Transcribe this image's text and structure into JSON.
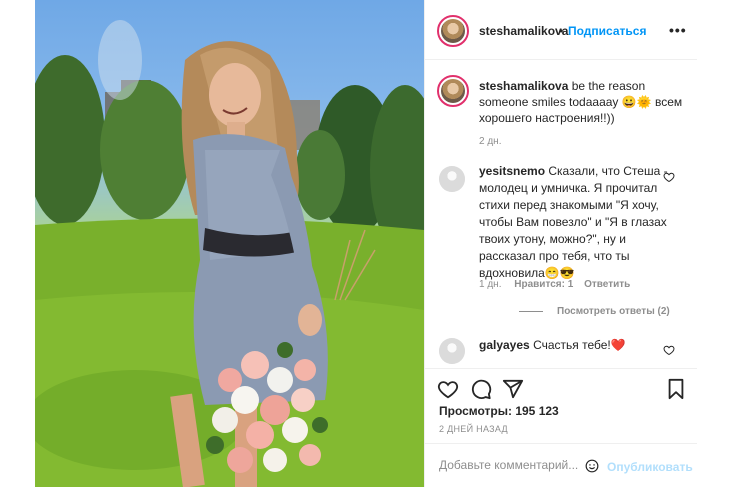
{
  "post": {
    "username": "steshamalikova",
    "dot": "•",
    "follow_label": "Подписаться",
    "more_label": "•••"
  },
  "caption": {
    "username": "steshamalikova",
    "text": "be the reason someone smiles todaaaay 😀🌞 всем хорошего настроения!!))",
    "time": "2 дн."
  },
  "comments": [
    {
      "username": "yesitsnemo",
      "text": "Сказали, что Стеша - молодец и умничка. Я прочитал стихи перед знакомыми \"Я хочу, чтобы Вам повезло\" и \"Я в глазах твоих утону, можно?\", ну и рассказал про тебя, что ты вдохновила😁😎",
      "time": "1 дн.",
      "likes": "Нравится: 1",
      "reply_label": "Ответить",
      "view_replies": "Посмотреть ответы (2)"
    },
    {
      "username": "galyayes",
      "text": "Счастья тебе!❤️"
    }
  ],
  "stats": {
    "views": "Просмотры: 195 123",
    "ago": "2 ДНЕЙ НАЗАД"
  },
  "compose": {
    "placeholder": "Добавьте комментарий...",
    "publish_label": "Опубликовать"
  },
  "icons": {
    "like": "heart-icon",
    "comment": "comment-icon",
    "share": "paper-plane-icon",
    "save": "bookmark-icon",
    "more": "more-dots-icon",
    "emoji": "smiley-icon"
  },
  "colors": {
    "link": "#0095f6",
    "publish_disabled": "#b2dffc",
    "muted": "#8e8e8e",
    "text": "#262626",
    "ring": "#e1306c",
    "heart_red": "#ed4956"
  }
}
